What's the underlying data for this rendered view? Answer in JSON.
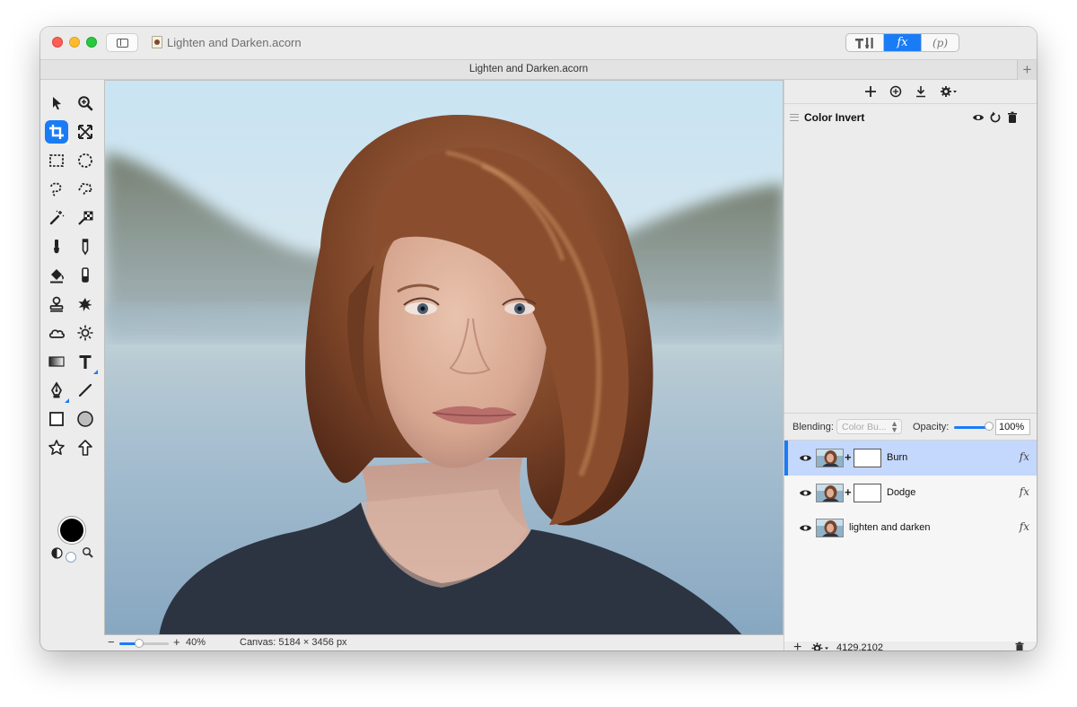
{
  "window": {
    "title": "Lighten and Darken.acorn",
    "tab_title": "Lighten and Darken.acorn"
  },
  "palette_switcher": {
    "items": [
      "tools-palette",
      "fx",
      "p"
    ],
    "fx_label": "fx",
    "p_label": "p",
    "active": "fx"
  },
  "toolbox": {
    "tools": [
      "select-tool",
      "zoom-tool",
      "crop-tool",
      "transform-tool",
      "rect-select-tool",
      "ellipse-select-tool",
      "lasso-tool",
      "polygon-lasso-tool",
      "magic-wand-tool",
      "instant-alpha-tool",
      "brush-tool",
      "pencil-tool",
      "paint-bucket-tool",
      "eraser-tool",
      "clone-tool",
      "effects-brush-tool",
      "burn-tool",
      "dodge-tool",
      "gradient-tool",
      "text-tool",
      "pen-tool",
      "line-tool",
      "rectangle-tool",
      "circle-tool",
      "star-tool",
      "arrow-shape-tool"
    ],
    "selected": "crop-tool",
    "foreground_color": "#000000",
    "background_color": "#ffffff"
  },
  "canvas": {
    "image_subject": "portrait photo"
  },
  "status": {
    "zoom_level": "40%",
    "zoom_fraction": 0.4,
    "canvas_info": "Canvas: 5184 × 3456 px"
  },
  "filters_panel": {
    "toolbar_icons": [
      "add-filter-icon",
      "filter-presets-icon",
      "apply-filter-icon",
      "gear-icon"
    ],
    "filters": [
      {
        "name": "Color Invert"
      }
    ]
  },
  "layers_panel": {
    "blending_label": "Blending:",
    "blending_value": "Color Bu...",
    "opacity_label": "Opacity:",
    "opacity_value": "100%",
    "layers": [
      {
        "name": "Burn",
        "has_mask": true,
        "selected": true,
        "fx": "fx"
      },
      {
        "name": "Dodge",
        "has_mask": true,
        "selected": false,
        "fx": "fx"
      },
      {
        "name": "lighten and darken",
        "has_mask": false,
        "selected": false,
        "fx": "fx"
      }
    ],
    "footer": {
      "coordinates": "4129,2102"
    }
  },
  "colors": {
    "accent": "#1a7cf5",
    "selected_row": "#c4d7fc"
  }
}
